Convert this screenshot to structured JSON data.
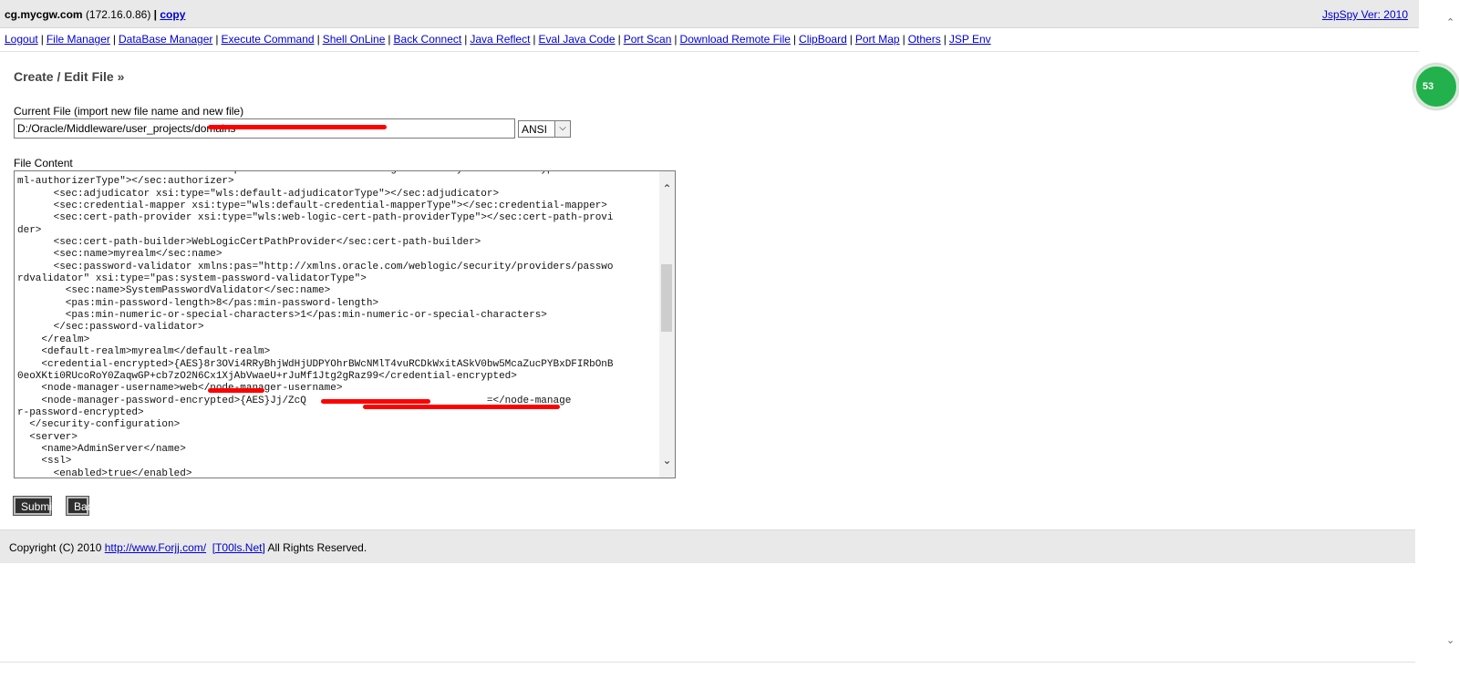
{
  "header": {
    "host": "cg.mycgw.com",
    "ip": "(172.16.0.86)",
    "separator": "|",
    "copy_label": "copy",
    "version": "JspSpy Ver: 2010"
  },
  "nav": [
    "Logout",
    "File Manager",
    "DataBase Manager",
    "Execute Command",
    "Shell OnLine",
    "Back Connect",
    "Java Reflect",
    "Eval Java Code",
    "Port Scan",
    "Download Remote File",
    "ClipBoard",
    "Port Map",
    "Others",
    "JSP Env"
  ],
  "editor_form": {
    "title": "Create / Edit File »",
    "current_file_label": "Current File (import new file name and new file)",
    "current_file_value": "D:/Oracle/Middleware/user_projects/domains",
    "encoding_selected": "ANSI",
    "file_content_label": "File Content",
    "content_lines": [
      "      <sec:authorizer xmlns:xac=\"http://xmlns.oracle.com/weblogic/security/xacml\" xsi:type=\"xac:xac",
      "ml-authorizerType\"></sec:authorizer>",
      "      <sec:adjudicator xsi:type=\"wls:default-adjudicatorType\"></sec:adjudicator>",
      "      <sec:credential-mapper xsi:type=\"wls:default-credential-mapperType\"></sec:credential-mapper>",
      "      <sec:cert-path-provider xsi:type=\"wls:web-logic-cert-path-providerType\"></sec:cert-path-provi",
      "der>",
      "      <sec:cert-path-builder>WebLogicCertPathProvider</sec:cert-path-builder>",
      "      <sec:name>myrealm</sec:name>",
      "      <sec:password-validator xmlns:pas=\"http://xmlns.oracle.com/weblogic/security/providers/passwo",
      "rdvalidator\" xsi:type=\"pas:system-password-validatorType\">",
      "        <sec:name>SystemPasswordValidator</sec:name>",
      "        <pas:min-password-length>8</pas:min-password-length>",
      "        <pas:min-numeric-or-special-characters>1</pas:min-numeric-or-special-characters>",
      "      </sec:password-validator>",
      "    </realm>",
      "    <default-realm>myrealm</default-realm>",
      "    <credential-encrypted>{AES}8r3OVi4RRyBhjWdHjUDPYOhrBWcNMlT4vuRCDkWxitASkV0bw5McaZucPYBxDFIRbOnB",
      "0eoXKti0RUcoRoY0ZaqwGP+cb7zO2N6Cx1XjAbVwaeU+rJuMf1Jtg2gRaz99</credential-encrypted>",
      "    <node-manager-username>web</node-manager-username>",
      "    <node-manager-password-encrypted>{AES}Jj/ZcQ                              =</node-manage",
      "r-password-encrypted>",
      "  </security-configuration>",
      "  <server>",
      "    <name>AdminServer</name>",
      "    <ssl>",
      "      <enabled>true</enabled>"
    ],
    "submit_label": "Submit",
    "back_label": "Back"
  },
  "footer": {
    "copyright": "Copyright (C) 2010",
    "site_link": "http://www.Forjj.com/",
    "team_link": "[T00ls.Net]",
    "rights": "All Rights Reserved."
  },
  "badge": {
    "value": "53"
  },
  "colors": {
    "redaction": "#ff0000",
    "link": "#0000cc",
    "badge": "#22b14c"
  }
}
